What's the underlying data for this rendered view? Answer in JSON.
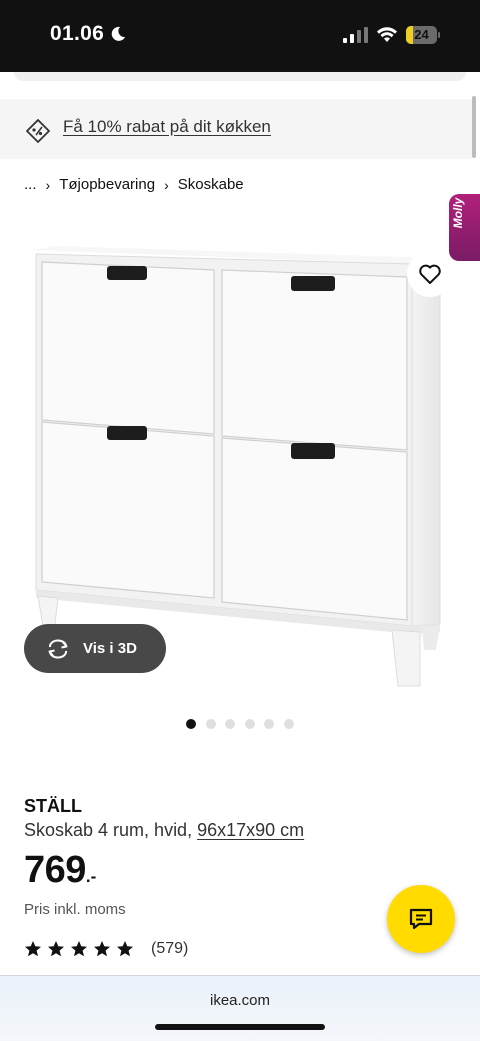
{
  "status_bar": {
    "time": "01.06",
    "battery": "24",
    "battery_fraction": 0.24
  },
  "promo": {
    "text": "Få 10% rabat på dit køkken",
    "icon": "tag-icon"
  },
  "breadcrumb": {
    "items": [
      "...",
      "Tøjopbevaring",
      "Skoskabe"
    ]
  },
  "molly": {
    "label": "Molly"
  },
  "gallery": {
    "view_3d_label": "Vis i 3D",
    "dot_count": 6,
    "active_index": 0
  },
  "product": {
    "name": "STÄLL",
    "description": "Skoskab 4 rum, hvid, ",
    "measurement": "96x17x90 cm",
    "price": "769",
    "price_suffix": ".-",
    "price_note": "Pris inkl. moms",
    "rating_stars": 5,
    "review_count": "(579)"
  },
  "browser": {
    "url": "ikea.com"
  },
  "colors": {
    "accent_yellow": "#ffdb00",
    "molly_purple": "#9b1e72",
    "status_bg": "#111111"
  }
}
